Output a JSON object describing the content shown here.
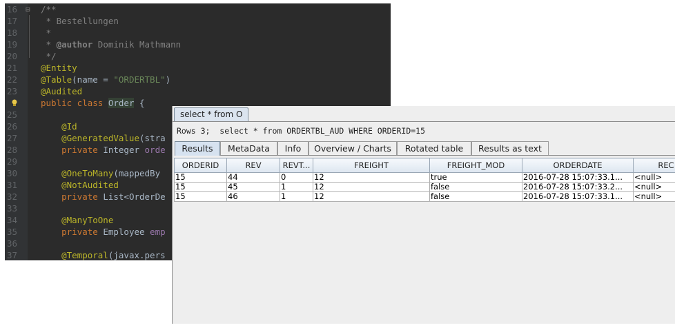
{
  "editor": {
    "lines": [
      {
        "num": "16",
        "parts": [
          {
            "t": "/**",
            "c": "c-com"
          }
        ]
      },
      {
        "num": "17",
        "parts": [
          {
            "t": " * Bestellungen",
            "c": "c-com"
          }
        ]
      },
      {
        "num": "18",
        "parts": [
          {
            "t": " *",
            "c": "c-com"
          }
        ]
      },
      {
        "num": "19",
        "parts": [
          {
            "t": " * ",
            "c": "c-com"
          },
          {
            "t": "@author",
            "c": "c-tag"
          },
          {
            "t": " Dominik Mathmann",
            "c": "c-com"
          }
        ]
      },
      {
        "num": "20",
        "parts": [
          {
            "t": " */",
            "c": "c-com"
          }
        ]
      },
      {
        "num": "21",
        "parts": [
          {
            "t": "@Entity",
            "c": "c-ann"
          }
        ]
      },
      {
        "num": "22",
        "parts": [
          {
            "t": "@Table",
            "c": "c-ann"
          },
          {
            "t": "(name = ",
            "c": ""
          },
          {
            "t": "\"ORDERTBL\"",
            "c": "c-str"
          },
          {
            "t": ")",
            "c": ""
          }
        ]
      },
      {
        "num": "23",
        "parts": [
          {
            "t": "@Audited",
            "c": "c-ann"
          }
        ]
      },
      {
        "num": "",
        "parts": [
          {
            "t": "public class ",
            "c": "c-kw"
          },
          {
            "t": "Order",
            "c": "c-hl"
          },
          {
            "t": " {",
            "c": ""
          }
        ]
      },
      {
        "num": "25",
        "parts": []
      },
      {
        "num": "26",
        "parts": [
          {
            "t": "    @Id",
            "c": "c-ann"
          }
        ]
      },
      {
        "num": "27",
        "parts": [
          {
            "t": "    @GeneratedValue",
            "c": "c-ann"
          },
          {
            "t": "(stra",
            "c": ""
          }
        ]
      },
      {
        "num": "28",
        "parts": [
          {
            "t": "    private ",
            "c": "c-kw"
          },
          {
            "t": "Integer ",
            "c": ""
          },
          {
            "t": "orde",
            "c": "c-field"
          }
        ]
      },
      {
        "num": "29",
        "parts": []
      },
      {
        "num": "30",
        "parts": [
          {
            "t": "    @OneToMany",
            "c": "c-ann"
          },
          {
            "t": "(mappedBy",
            "c": ""
          }
        ]
      },
      {
        "num": "31",
        "parts": [
          {
            "t": "    @NotAudited",
            "c": "c-ann"
          }
        ]
      },
      {
        "num": "32",
        "parts": [
          {
            "t": "    private ",
            "c": "c-kw"
          },
          {
            "t": "List<OrderDe",
            "c": ""
          }
        ]
      },
      {
        "num": "33",
        "parts": []
      },
      {
        "num": "34",
        "parts": [
          {
            "t": "    @ManyToOne",
            "c": "c-ann"
          }
        ]
      },
      {
        "num": "35",
        "parts": [
          {
            "t": "    private ",
            "c": "c-kw"
          },
          {
            "t": "Employee ",
            "c": ""
          },
          {
            "t": "emp",
            "c": "c-field"
          }
        ]
      },
      {
        "num": "36",
        "parts": []
      },
      {
        "num": "37",
        "parts": [
          {
            "t": "    @Temporal",
            "c": "c-ann"
          },
          {
            "t": "(javax.pers",
            "c": ""
          }
        ]
      }
    ]
  },
  "results": {
    "window_tab": "select * from O",
    "rows_summary": "Rows 3;  select * from ORDERTBL_AUD WHERE ORDERID=15",
    "tabs": [
      "Results",
      "MetaData",
      "Info",
      "Overview / Charts",
      "Rotated table",
      "Results as text"
    ],
    "columns": [
      "ORDERID",
      "REV",
      "REVT...",
      "FREIGHT",
      "FREIGHT_MOD",
      "ORDERDATE",
      "REC"
    ],
    "rows": [
      [
        "15",
        "44",
        "0",
        "12",
        "true",
        "2016-07-28 15:07:33.1...",
        "<null>"
      ],
      [
        "15",
        "45",
        "1",
        "12",
        "false",
        "2016-07-28 15:07:33.2...",
        "<null>"
      ],
      [
        "15",
        "46",
        "1",
        "12",
        "false",
        "2016-07-28 15:07:33.1...",
        "<null>"
      ]
    ]
  }
}
